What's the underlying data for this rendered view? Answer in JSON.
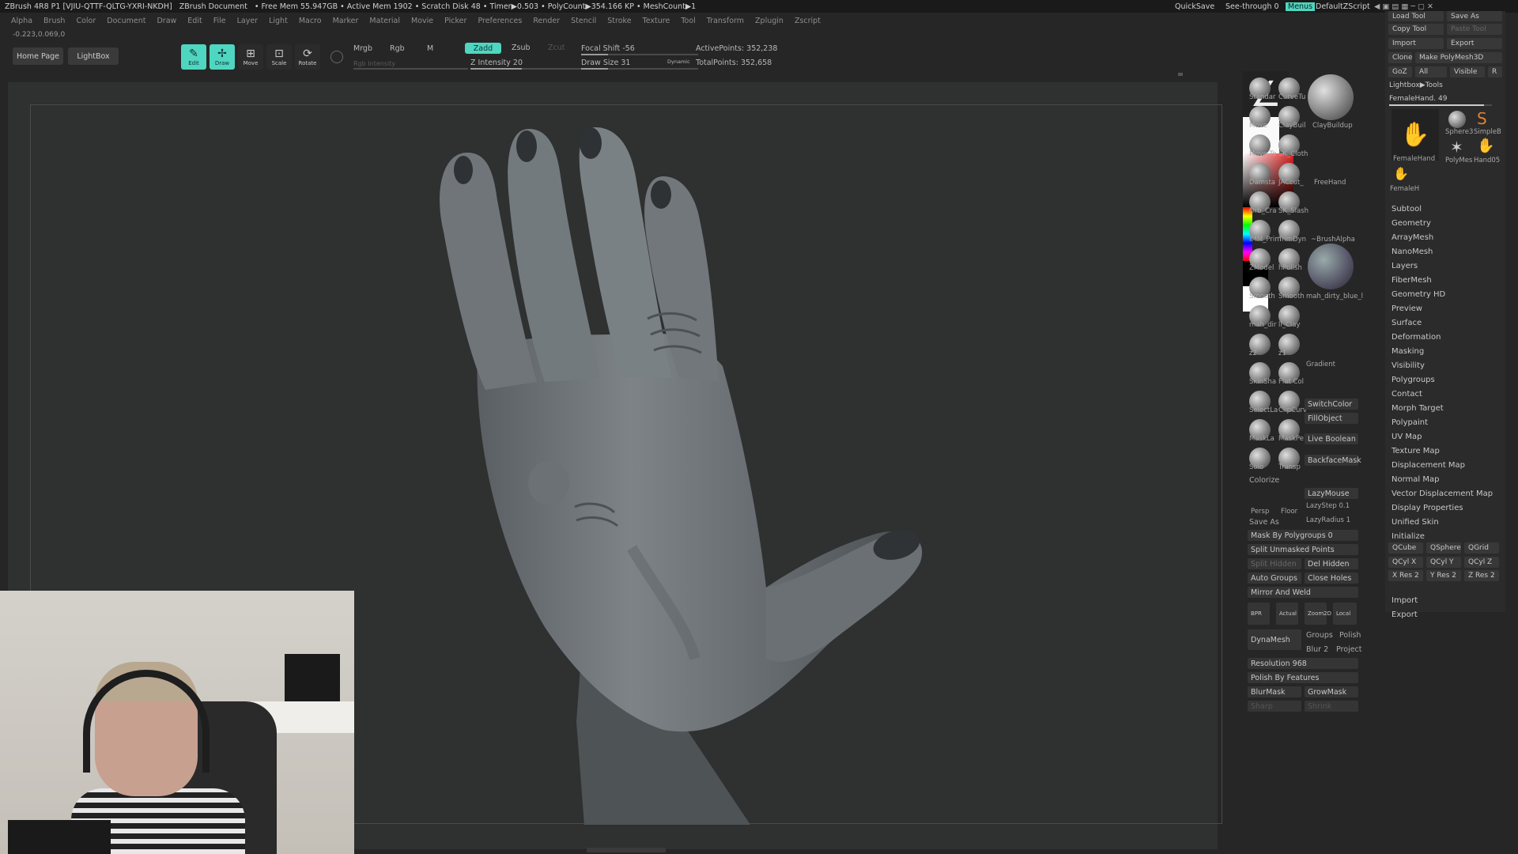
{
  "titlebar": {
    "app": "ZBrush 4R8 P1 [VJIU-QTTF-QLTG-YXRI-NKDH]",
    "document": "ZBrush Document",
    "stats": "• Free Mem 55.947GB • Active Mem 1902 • Scratch Disk 48 • Timer▶0.503 • PolyCount▶354.166 KP • MeshCount▶1",
    "quicksave": "QuickSave",
    "seethrough": "See-through  0",
    "menus": "Menus",
    "zscript": "DefaultZScript"
  },
  "menubar": [
    "Alpha",
    "Brush",
    "Color",
    "Document",
    "Draw",
    "Edit",
    "File",
    "Layer",
    "Light",
    "Macro",
    "Marker",
    "Material",
    "Movie",
    "Picker",
    "Preferences",
    "Render",
    "Stencil",
    "Stroke",
    "Texture",
    "Tool",
    "Transform",
    "Zplugin",
    "Zscript"
  ],
  "coords": "-0.223,0.069,0",
  "toolbar": {
    "home": "Home Page",
    "lightbox": "LightBox",
    "edit": "Edit",
    "draw": "Draw",
    "move": "Move",
    "scale": "Scale",
    "rotate": "Rotate",
    "mrgb": "Mrgb",
    "rgb": "Rgb",
    "m": "M",
    "rgb_intensity": "Rgb Intensity",
    "zadd": "Zadd",
    "zsub": "Zsub",
    "zcut": "Zcut",
    "z_intensity": "Z Intensity 20",
    "focal_shift": "Focal Shift -56",
    "draw_size": "Draw Size 31",
    "dynamic": "Dynamic",
    "active_points": "ActivePoints: 352,238",
    "total_points": "TotalPoints: 352,658"
  },
  "brushes": [
    [
      "Standar",
      "CurveTu"
    ],
    [
      "Move",
      "ClayBuil"
    ],
    [
      "Move To",
      "SK_Cloth"
    ],
    [
      "Damsta",
      "JACcut_"
    ],
    [
      "Orb_Cra",
      "SK_Slash"
    ],
    [
      "IMM_Prim",
      "TrimDyn"
    ],
    [
      "ZModel",
      "hPolish"
    ],
    [
      "Smooth",
      "Smooth"
    ],
    [
      "mah_dir",
      "ll_Clay"
    ],
    [
      "z2",
      "z1"
    ],
    [
      "SkinSha",
      "Flat Col"
    ],
    [
      "SelectLa",
      "ClipCurv"
    ],
    [
      "MaskLa",
      "MaskPe"
    ],
    [
      "Solo",
      "Transp"
    ]
  ],
  "big": {
    "claybuildup": "ClayBuildup",
    "freehand": "FreeHand",
    "brushalpha": "~BrushAlpha",
    "material": "mah_dirty_blue_l",
    "gradient": "Gradient",
    "switchcolor": "SwitchColor",
    "fillobject": "FillObject",
    "liveboolean": "Live Boolean",
    "backfacemask": "BackfaceMask",
    "colorize": "Colorize",
    "persp": "Persp",
    "floor": "Floor",
    "lazymouse": "LazyMouse",
    "lazystep": "LazyStep 0.1",
    "lazyradius": "LazyRadius 1",
    "saveas": "Save As",
    "maskbypoly": "Mask By Polygroups 0",
    "splitunmasked": "Split Unmasked Points",
    "splithidden": "Split Hidden",
    "delhidden": "Del Hidden",
    "autogroups": "Auto Groups",
    "closeholes": "Close Holes",
    "mirrorweld": "Mirror And Weld",
    "bpr": "BPR",
    "actual": "Actual",
    "zoom": "Zoom2D",
    "local": "Local",
    "dynamesh": "DynaMesh",
    "groups": "Groups",
    "polish": "Polish",
    "blur": "Blur 2",
    "project": "Project",
    "resolution": "Resolution 968",
    "polishfeatures": "Polish By Features",
    "blurmask": "BlurMask",
    "growmask": "GrowMask",
    "sharpen": "Sharp",
    "shrink": "Shrink"
  },
  "toolpanel": {
    "loadtool": "Load Tool",
    "saveas": "Save As",
    "copytool": "Copy Tool",
    "pastetool": "Paste Tool",
    "import": "Import",
    "export": "Export",
    "clone": "Clone",
    "makepoly": "Make PolyMesh3D",
    "goz": "GoZ",
    "all": "All",
    "visible": "Visible",
    "r": "R",
    "lightboxtools": "Lightbox▶Tools",
    "current": "FemaleHand. 49",
    "thumbs": [
      "FemaleHand",
      "Sphere3",
      "SimpleB",
      "PolyMes",
      "Hand05",
      "FemaleH"
    ],
    "menu": [
      "Subtool",
      "Geometry",
      "ArrayMesh",
      "NanoMesh",
      "Layers",
      "FiberMesh",
      "Geometry HD",
      "Preview",
      "Surface",
      "Deformation",
      "Masking",
      "Visibility",
      "Polygroups",
      "Contact",
      "Morph Target",
      "Polypaint",
      "UV Map",
      "Texture Map",
      "Displacement Map",
      "Normal Map",
      "Vector Displacement Map",
      "Display Properties",
      "Unified Skin",
      "Initialize"
    ],
    "qcube": "QCube",
    "qsphere": "QSphere",
    "qgrid": "QGrid",
    "qcylx": "QCyl X",
    "qcyly": "QCyl Y",
    "qcylz": "QCyl Z",
    "xres": "X Res 2",
    "yres": "Y Res 2",
    "zres": "Z Res 2",
    "import2": "Import",
    "export2": "Export"
  }
}
